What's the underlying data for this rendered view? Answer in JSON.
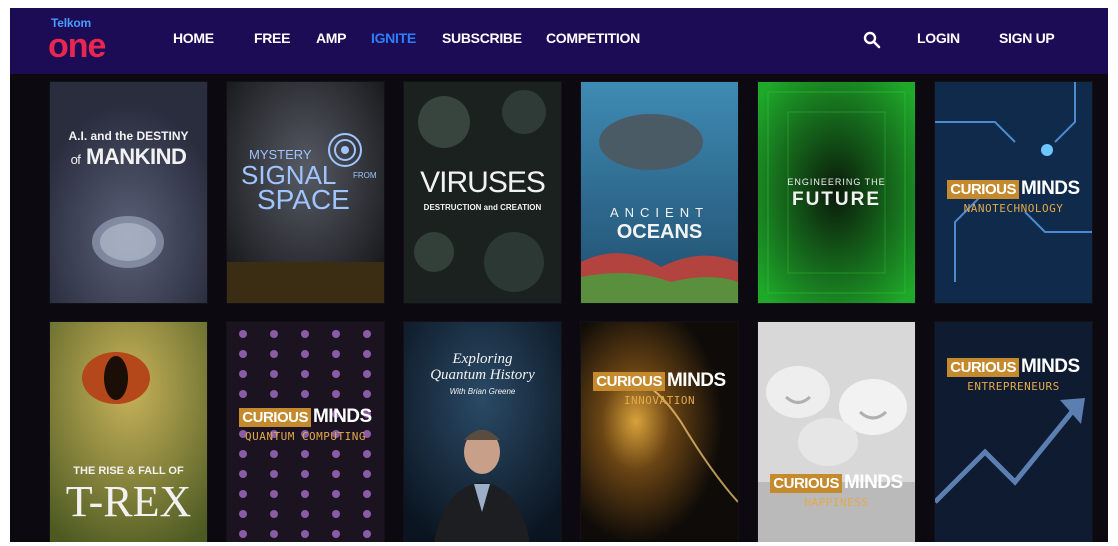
{
  "brand": {
    "small": "Telkom",
    "big": "one"
  },
  "nav": {
    "items": [
      {
        "label": "HOME",
        "active": false
      },
      {
        "label": "FREE",
        "active": false
      },
      {
        "label": "AMP",
        "active": false
      },
      {
        "label": "IGNITE",
        "active": true
      },
      {
        "label": "SUBSCRIBE",
        "active": false
      },
      {
        "label": "COMPETITION",
        "active": false
      }
    ],
    "search_icon": "search-icon",
    "login": "LOGIN",
    "signup": "SIGN UP"
  },
  "colors": {
    "nav_bg": "#1c0b55",
    "active": "#2d7ff9",
    "logo": "#e8264f",
    "curious": "#c58a2e"
  },
  "tiles": [
    {
      "line1": "A.I. and the DESTINY",
      "line2": "of",
      "line3": "MANKIND"
    },
    {
      "line1": "MYSTERY",
      "line2": "SIGNAL",
      "line3": "FROM",
      "line4": "SPACE"
    },
    {
      "line1": "VIRUSES",
      "line2": "DESTRUCTION and CREATION"
    },
    {
      "line1": "ANCIENT",
      "line2": "OCEANS"
    },
    {
      "line1": "ENGINEERING THE",
      "line2": "FUTURE"
    },
    {
      "line1": "CURIOUS",
      "line2": "MINDS",
      "line3": "NANOTECHNOLOGY"
    },
    {
      "line1": "THE RISE & FALL OF",
      "line2": "T-REX"
    },
    {
      "line1": "CURIOUS",
      "line2": "MINDS",
      "line3": "QUANTUM COMPUTING"
    },
    {
      "line1": "Exploring",
      "line2": "Quantum History",
      "line3": "With Brian Greene"
    },
    {
      "line1": "CURIOUS",
      "line2": "MINDS",
      "line3": "INNOVATION"
    },
    {
      "line1": "CURIOUS",
      "line2": "MINDS",
      "line3": "HAPPINESS"
    },
    {
      "line1": "CURIOUS",
      "line2": "MINDS",
      "line3": "ENTREPRENEURS"
    }
  ]
}
